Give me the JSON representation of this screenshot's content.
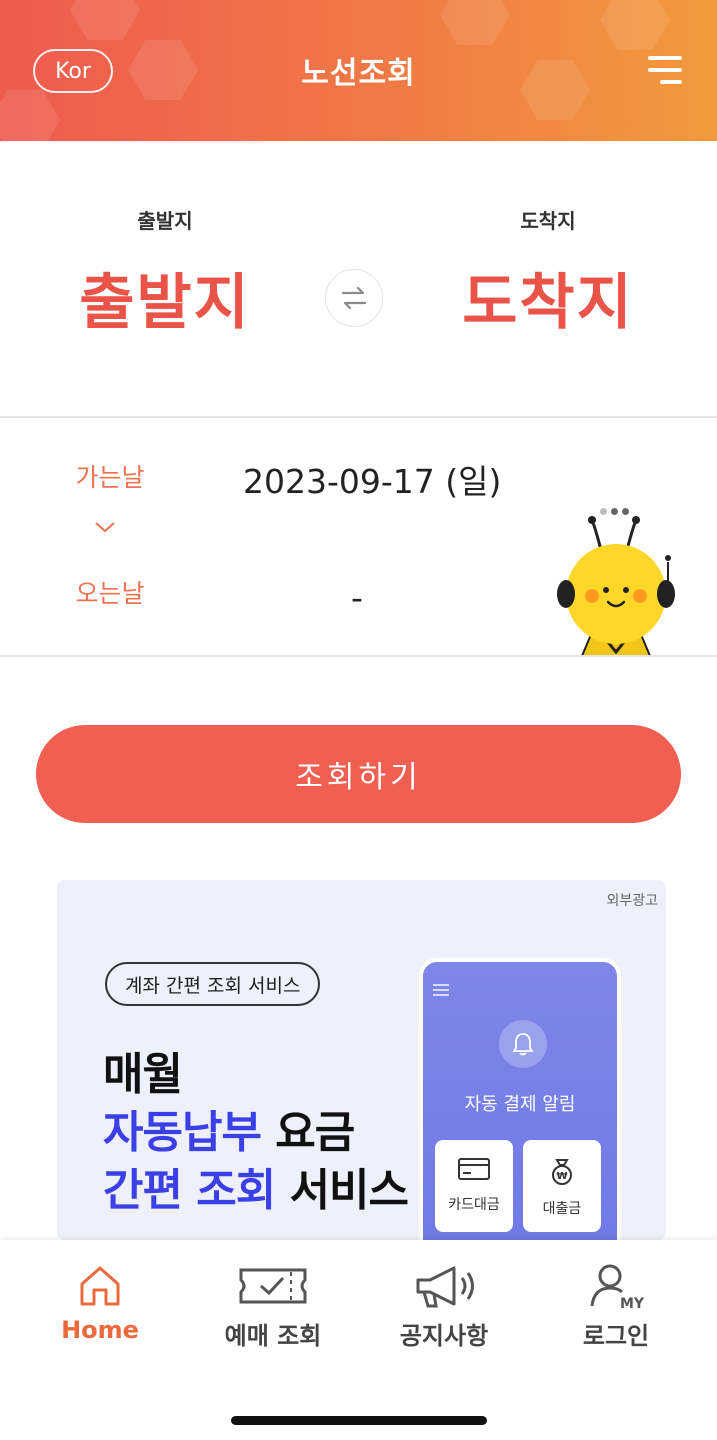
{
  "header": {
    "language_button": "Kor",
    "title": "노선조회",
    "menu_icon": "hamburger-menu-icon",
    "gradient_colors": [
      "#ef5a4f",
      "#f29a3c"
    ]
  },
  "route": {
    "departure_caption": "출발지",
    "departure_value": "출발지",
    "arrival_caption": "도착지",
    "arrival_value": "도착지",
    "swap_icon": "swap-arrows-icon",
    "accent_color": "#ea5348"
  },
  "dates": {
    "depart_label": "가는날",
    "depart_value": "2023-09-17 (일)",
    "return_label": "오는날",
    "return_value": "-",
    "toggle_icon": "chevron-down-icon"
  },
  "mascot": {
    "icon": "bee-mascot-icon"
  },
  "search_button": {
    "label": "조회하기",
    "color": "#f05f52"
  },
  "ad": {
    "tag": "외부광고",
    "pill": "계좌 간편 조회 서비스",
    "line1": "매월",
    "line2_blue": "자동납부",
    "line2_dark": "요금",
    "line3_blue": "간편 조회",
    "line3_dark": "서비스",
    "phone_title": "자동 결제 알림",
    "card1": "카드대금",
    "card2": "대출금"
  },
  "bottom_nav": {
    "items": [
      {
        "label": "Home",
        "icon": "home-icon",
        "active": true
      },
      {
        "label": "예매 조회",
        "icon": "ticket-check-icon",
        "active": false
      },
      {
        "label": "공지사항",
        "icon": "megaphone-icon",
        "active": false
      },
      {
        "label": "로그인",
        "icon": "my-user-icon",
        "active": false
      }
    ],
    "active_color": "#ea6a3b"
  }
}
